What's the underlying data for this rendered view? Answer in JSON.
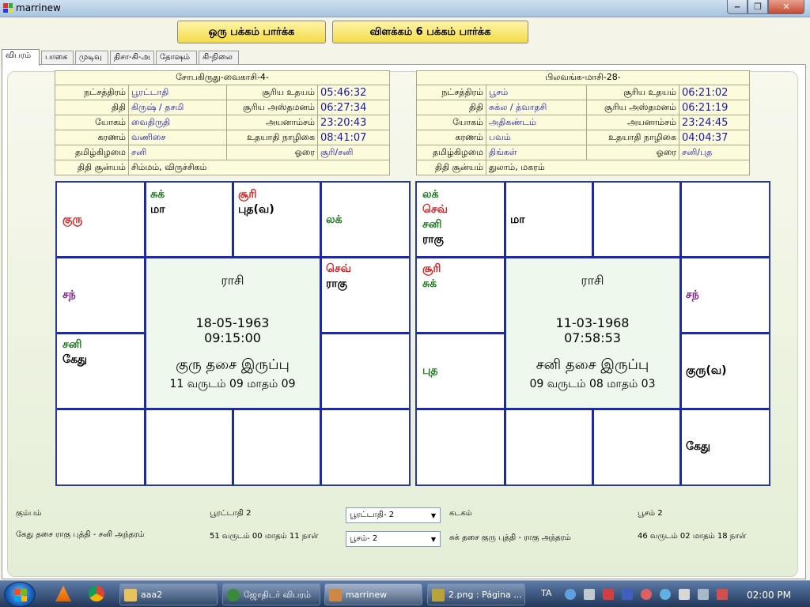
{
  "window": {
    "title": "marrinew"
  },
  "toolbar": {
    "btn1": "ஒரு பக்கம் பார்க்க",
    "btn2": "விளக்கம் 6 பக்கம் பார்க்க"
  },
  "tabs": [
    "விபரம்",
    "பாகை",
    "முடிவு",
    "திசா-கி-அ",
    "தோஷம்",
    "கி-நிலை"
  ],
  "left": {
    "header": "சோபகிருது-வைகாசி-4-",
    "rows": [
      {
        "l1": "நட்சத்திரம்",
        "v1": "பூரட்டாதி",
        "l2": "சூரிய உதயம்",
        "v2": "05:46:32"
      },
      {
        "l1": "திதி",
        "v1": "கிருஷ் / தசமி",
        "l2": "சூரிய அஸ்தமனம்",
        "v2": "06:27:34"
      },
      {
        "l1": "யோகம்",
        "v1": "வைதிருதி",
        "l2": "அயனாம்சம்",
        "v2": "23:20:43"
      },
      {
        "l1": "கரணம்",
        "v1": "வணிசை",
        "l2": "உதயாதி நாழிகை",
        "v2": "08:41:07"
      },
      {
        "l1": "தமிழ்கிழமை",
        "v1": "சனி",
        "l2": "ஓரை",
        "v2": "சூரி/சனி"
      }
    ],
    "shunya_label": "திதி சூன்யம்",
    "shunya_val": "சிம்மம், விருச்சிகம்",
    "chart": {
      "rasi": "ராசி",
      "date": "18-05-1963",
      "time": "09:15:00",
      "dasa": "குரு தசை இருப்பு",
      "balance": "11 வருடம் 09 மாதம் 09",
      "c0": [
        {
          "t": "குரு",
          "c": "pr"
        }
      ],
      "c1": [
        {
          "t": "சுக்",
          "c": "pg"
        },
        {
          "t": "மா",
          "c": "pb"
        }
      ],
      "c2": [
        {
          "t": "சூரி",
          "c": "pr"
        },
        {
          "t": "புத(வ)",
          "c": "pb"
        }
      ],
      "c3": [
        {
          "t": "லக்",
          "c": "pg"
        }
      ],
      "c4": [
        {
          "t": "சந்",
          "c": "pp"
        }
      ],
      "c5": [
        {
          "t": "செவ்",
          "c": "pr"
        },
        {
          "t": "ராகு",
          "c": "pb"
        }
      ],
      "c6": [
        {
          "t": "சனி",
          "c": "pg"
        },
        {
          "t": "கேது",
          "c": "pb"
        }
      ],
      "c7": [],
      "c8": [],
      "c9": [],
      "c10": [],
      "c11": []
    }
  },
  "right": {
    "header": "பிலவங்க-மாசி-28-",
    "rows": [
      {
        "l1": "நட்சத்திரம்",
        "v1": "பூசம்",
        "l2": "சூரிய உதயம்",
        "v2": "06:21:02"
      },
      {
        "l1": "திதி",
        "v1": "சுக்ல / த்வாதசி",
        "l2": "சூரிய அஸ்தமனம்",
        "v2": "06:21:19"
      },
      {
        "l1": "யோகம்",
        "v1": "அதிகண்டம்",
        "l2": "அயனாம்சம்",
        "v2": "23:24:45"
      },
      {
        "l1": "கரணம்",
        "v1": "பவம்",
        "l2": "உதயாதி நாழிகை",
        "v2": "04:04:37"
      },
      {
        "l1": "தமிழ்கிழமை",
        "v1": "திங்கள்",
        "l2": "ஓரை",
        "v2": "சனி/புத"
      }
    ],
    "shunya_label": "திதி சூன்யம்",
    "shunya_val": "துலாம், மகரம்",
    "chart": {
      "rasi": "ராசி",
      "date": "11-03-1968",
      "time": "07:58:53",
      "dasa": "சனி தசை இருப்பு",
      "balance": "09 வருடம் 08 மாதம் 03",
      "c0": [
        {
          "t": "லக்",
          "c": "pg"
        },
        {
          "t": "செவ்",
          "c": "pr"
        },
        {
          "t": "சனி",
          "c": "pg"
        },
        {
          "t": "ராகு",
          "c": "pb"
        }
      ],
      "c1": [
        {
          "t": "மா",
          "c": "pb"
        }
      ],
      "c2": [],
      "c3": [],
      "c4": [
        {
          "t": "சூரி",
          "c": "pr"
        },
        {
          "t": "சுக்",
          "c": "pg"
        }
      ],
      "c5": [
        {
          "t": "சந்",
          "c": "pp"
        }
      ],
      "c6": [
        {
          "t": "புத",
          "c": "pg"
        }
      ],
      "c7": [
        {
          "t": "குரு(வ)",
          "c": "pb"
        }
      ],
      "c8": [],
      "c9": [],
      "c10": [],
      "c11": [
        {
          "t": "கேது",
          "c": "pb"
        }
      ]
    }
  },
  "bottom": {
    "a1": "கும்பம்",
    "a2": "பூரட்டாதி 2",
    "combo1": "பூரட்டாதி- 2",
    "a3": "கடகம்",
    "a4": "பூசம் 2",
    "b1": "கேது தசை ராகு புத்தி - சனி அந்தரம்",
    "b2": "51 வருடம் 00 மாதம் 11 நாள்",
    "combo2": "பூசம்- 2",
    "b3": "சுக் தசை குரு புத்தி - ராகு அந்தரம்",
    "b4": "46 வருடம் 02 மாதம் 18 நாள்"
  },
  "taskbar": {
    "items": [
      "aaa2",
      "ஜோதிடர் விபரம்",
      "marrinew",
      "2.png : Página ..."
    ],
    "lang": "TA",
    "clock": "02:00 PM"
  },
  "colors": {
    "planet_green": "#1f7a1f",
    "planet_red": "#d81f1f",
    "planet_purple": "#7a1a8a",
    "grid_blue": "#1d2aa8",
    "value_blue": "#1a1aa8",
    "button_yellow": "#f3dc4a"
  }
}
